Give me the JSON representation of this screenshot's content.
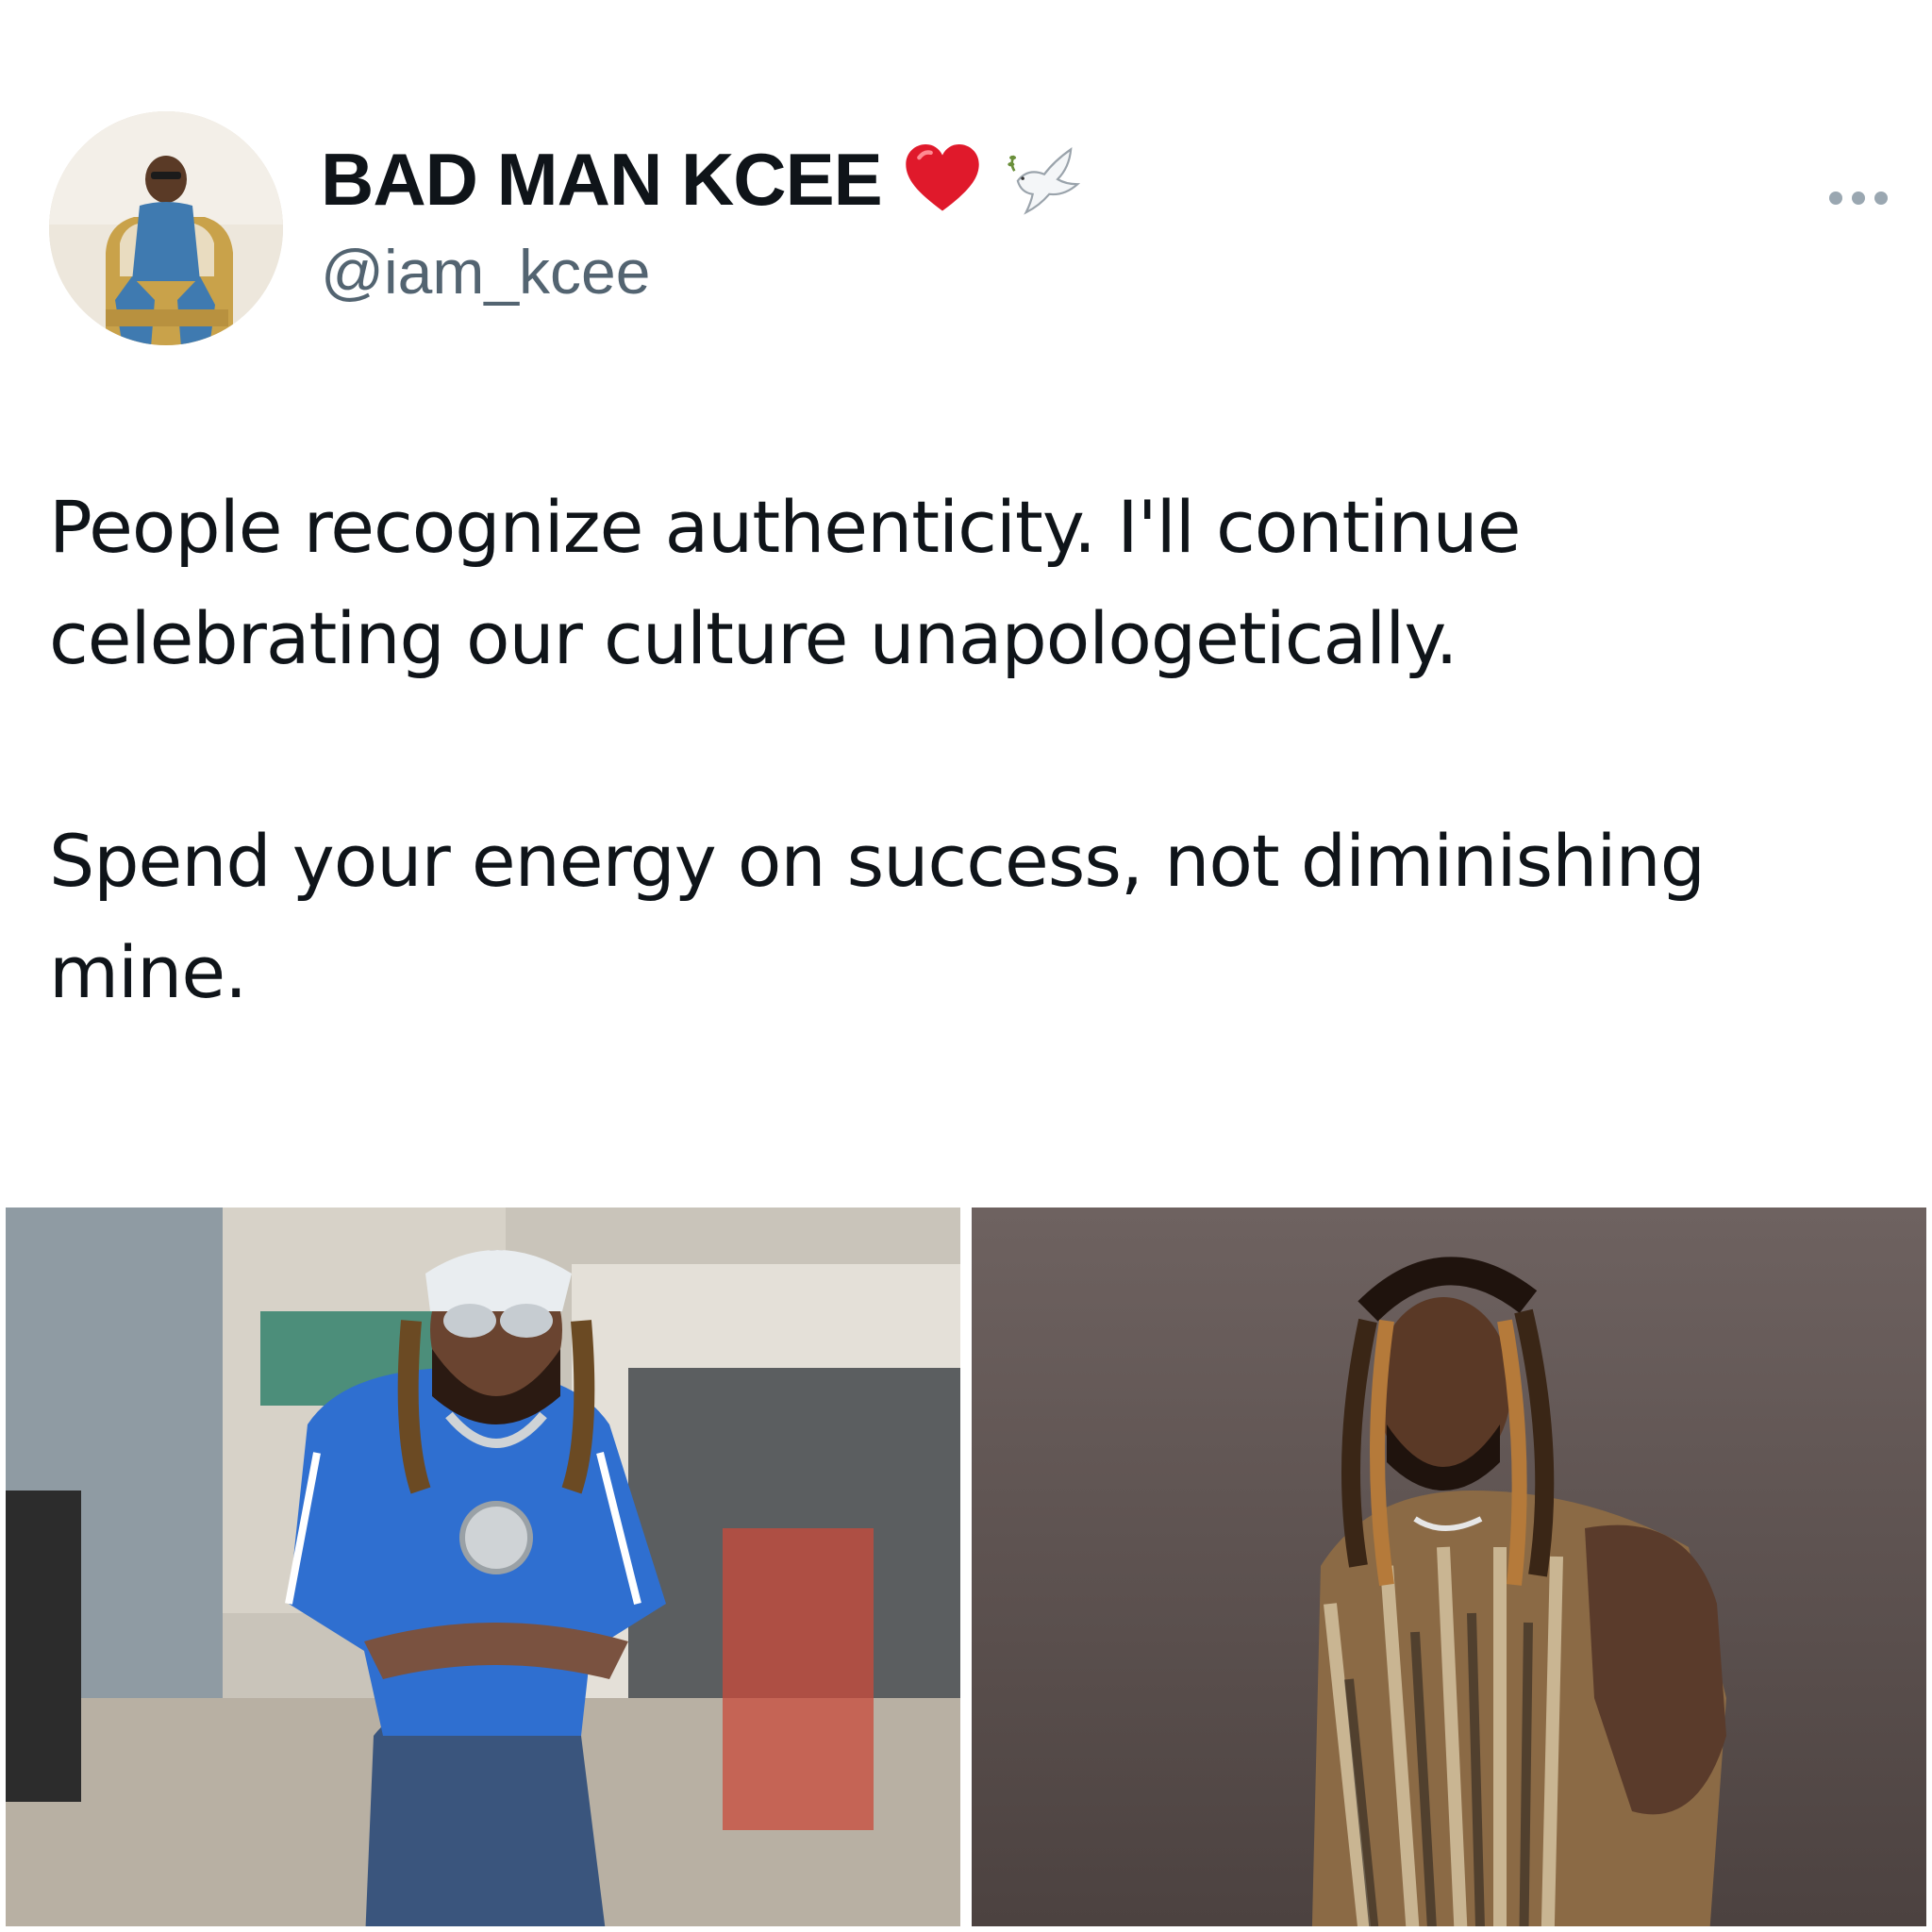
{
  "tweet": {
    "author": {
      "display_name": "BAD MAN KCEE",
      "handle": "@iam_kcee",
      "badges": [
        "red-heart-icon",
        "dove-icon"
      ]
    },
    "more_icon": "more-horizontal-icon",
    "text": {
      "paragraph_1": "People recognize authenticity. I'll continue celebrating our culture unapologetically.",
      "paragraph_2": "Spend your energy on success, not diminishing mine."
    },
    "media": [
      {
        "icon": "photo-man-blue-shirt-seated"
      },
      {
        "icon": "photo-man-sequin-vest"
      }
    ]
  },
  "colors": {
    "text_primary": "#0f1419",
    "text_secondary": "#536471",
    "heart": "#e0192b"
  }
}
